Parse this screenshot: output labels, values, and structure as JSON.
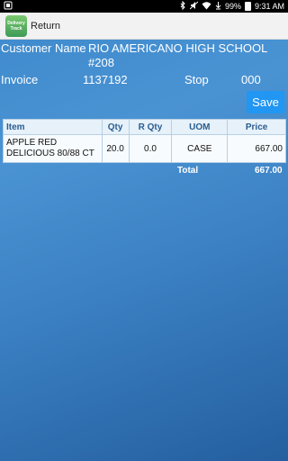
{
  "status_bar": {
    "battery": "99%",
    "time": "9:31 AM",
    "icons": [
      "notification-icon",
      "bluetooth-icon",
      "mute-icon",
      "wifi-icon",
      "download-icon",
      "battery-icon"
    ]
  },
  "app_bar": {
    "logo_text": "Delivery Track",
    "title": "Return"
  },
  "customer": {
    "label": "Customer Name",
    "value_line1": "RIO AMERICANO HIGH SCHOOL",
    "value_line2": "#208"
  },
  "invoice": {
    "label": "Invoice",
    "value": "1137192"
  },
  "stop": {
    "label": "Stop",
    "value": "000"
  },
  "save_button": "Save",
  "table": {
    "headers": [
      "Item",
      "Qty",
      "R Qty",
      "UOM",
      "Price"
    ],
    "rows": [
      [
        "APPLE RED DELICIOUS 80/88 CT",
        "20.0",
        "0.0",
        "CASE",
        "667.00"
      ]
    ]
  },
  "total": {
    "label": "Total",
    "value": "667.00"
  }
}
